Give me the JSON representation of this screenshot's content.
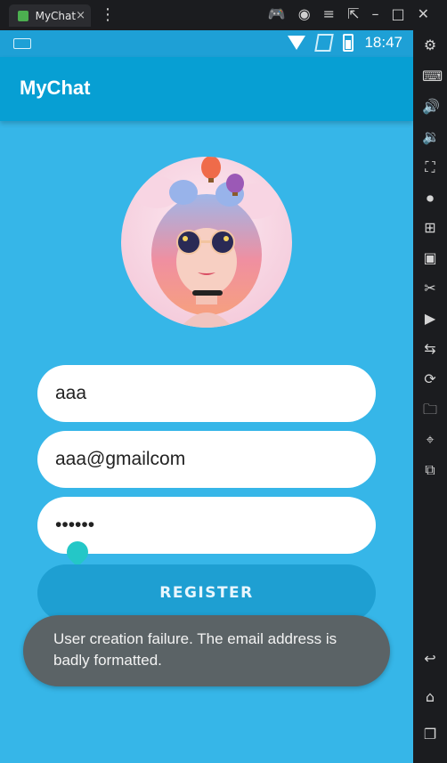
{
  "window": {
    "tab_label": "MyChat",
    "tab_close": "×",
    "more_menu": "⋮",
    "toolbar_icons": [
      "gamepad-icon",
      "account-icon",
      "menu-icon",
      "external-icon",
      "minimize-icon",
      "maximize-icon",
      "close-icon"
    ],
    "toolbar_glyphs": [
      "🎮",
      "◉",
      "≡",
      "⇱",
      "–",
      "□",
      "✕"
    ]
  },
  "status_bar": {
    "time": "18:47"
  },
  "app_bar": {
    "title": "MyChat"
  },
  "form": {
    "name_value": "aaa",
    "email_value": "aaa@gmailcom",
    "password_value": "••••••",
    "register_label": "REGISTER"
  },
  "toast": {
    "message": "User creation failure. The email address is badly formatted."
  },
  "sidebar": {
    "icons": [
      "settings-icon",
      "keymap-icon",
      "volume-up-icon",
      "volume-down-icon",
      "screen-icon",
      "record-icon",
      "add-window-icon",
      "apk-icon",
      "scissors-icon",
      "video-icon",
      "sync-icon",
      "shake-icon",
      "folder-icon",
      "location-icon",
      "vibrate-icon",
      "back-icon",
      "home-icon",
      "recents-icon"
    ],
    "glyphs": [
      "⚙",
      "⌨",
      "🔊",
      "🔉",
      "⛶",
      "⏺",
      "⊞",
      "▣",
      "✂",
      "▶",
      "⇆",
      "⟳",
      "🗀",
      "⌖",
      "⧉",
      "↩",
      "⌂",
      "❐"
    ]
  },
  "colors": {
    "phone_bg": "#36b6e8",
    "app_bar": "#079fd3",
    "register_button": "#1e9fd2",
    "toast_bg": "#5b6366"
  }
}
